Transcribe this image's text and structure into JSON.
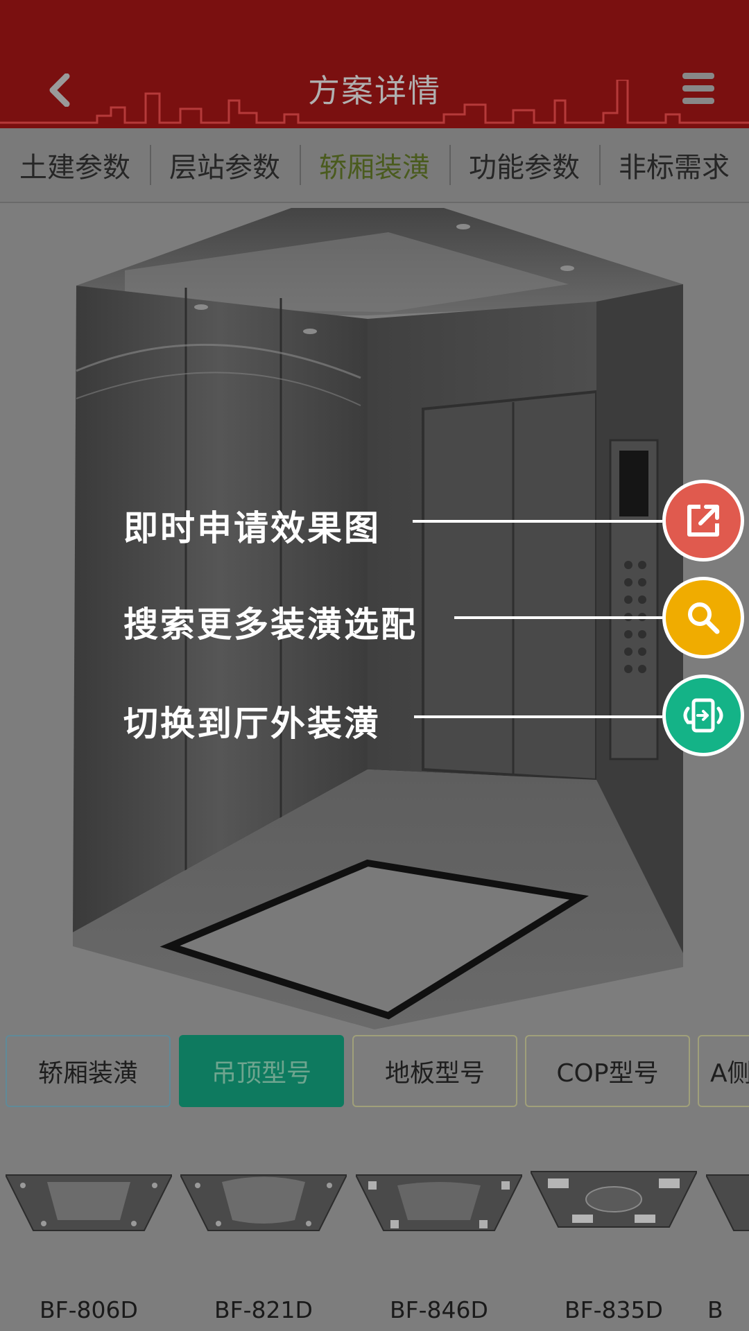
{
  "header": {
    "title": "方案详情"
  },
  "tabs": [
    {
      "label": "土建参数"
    },
    {
      "label": "层站参数"
    },
    {
      "label": "轿厢装潢"
    },
    {
      "label": "功能参数"
    },
    {
      "label": "非标需求"
    }
  ],
  "active_tab_index": 2,
  "actions": [
    {
      "label": "即时申请效果图",
      "icon": "external-link-icon",
      "color": "#e05a4e"
    },
    {
      "label": "搜索更多装潢选配",
      "icon": "search-icon",
      "color": "#f0ac00"
    },
    {
      "label": "切换到厅外装潢",
      "icon": "switch-view-icon",
      "color": "#14b387"
    }
  ],
  "categories": [
    {
      "label": "轿厢装潢"
    },
    {
      "label": "吊顶型号"
    },
    {
      "label": "地板型号"
    },
    {
      "label": "COP型号"
    },
    {
      "label": "A侧"
    }
  ],
  "active_category_index": 1,
  "ceilings": [
    {
      "code": "BF-806D"
    },
    {
      "code": "BF-821D"
    },
    {
      "code": "BF-846D"
    },
    {
      "code": "BF-835D"
    },
    {
      "code": "B"
    }
  ],
  "colors": {
    "header_bg": "#7a1010",
    "active_tab": "#4a5b1e",
    "active_category": "#0e7a5f"
  }
}
